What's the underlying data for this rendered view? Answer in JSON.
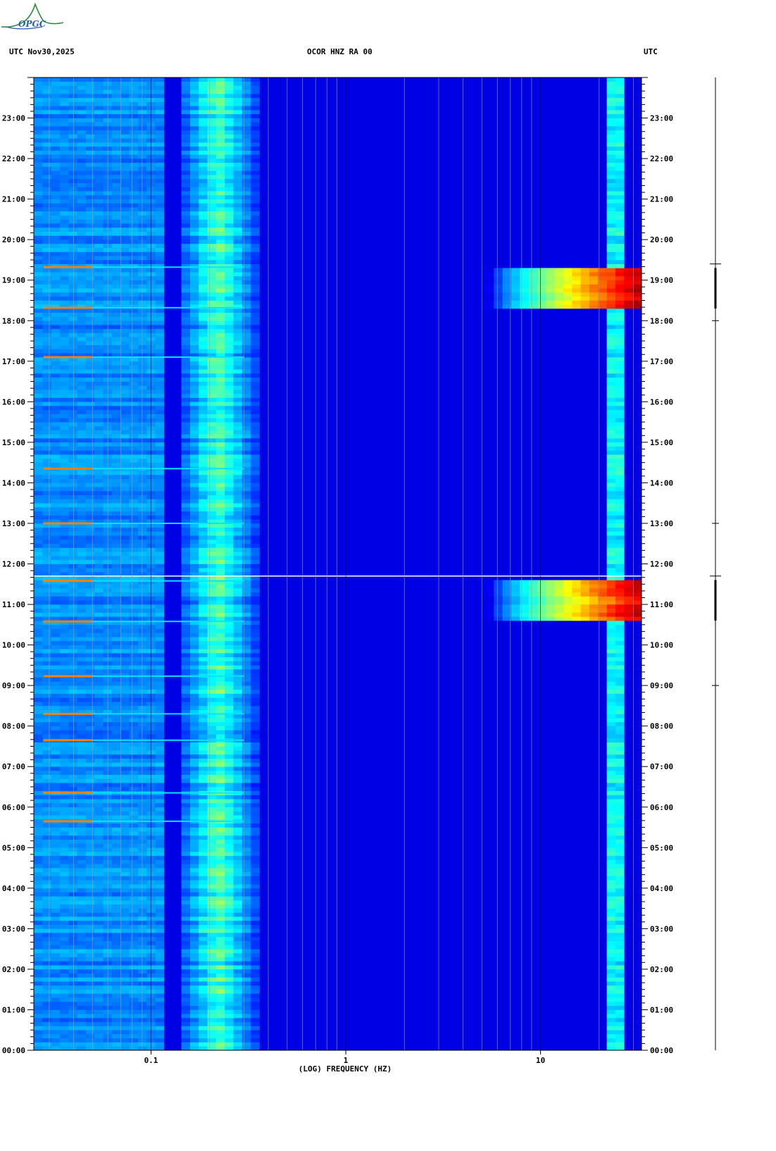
{
  "logo_text": "OPGC",
  "header": {
    "left": "UTC  Nov30,2025",
    "center": "OCOR HNZ RA 00",
    "right": "UTC"
  },
  "chart_data": {
    "type": "heatmap",
    "title": "OCOR HNZ RA 00",
    "date": "Nov30,2025",
    "xlabel": "(LOG) FREQUENCY (HZ)",
    "x_scale": "log",
    "xlim_hz": [
      0.025,
      33
    ],
    "x_ticks": [
      {
        "value": 0.1,
        "label": "0.1"
      },
      {
        "value": 1,
        "label": "1"
      },
      {
        "value": 10,
        "label": "10"
      }
    ],
    "ylabel": "UTC",
    "ylim_hours": [
      0,
      24
    ],
    "y_ticks": [
      "00:00",
      "01:00",
      "02:00",
      "03:00",
      "04:00",
      "05:00",
      "06:00",
      "07:00",
      "08:00",
      "09:00",
      "10:00",
      "11:00",
      "12:00",
      "13:00",
      "14:00",
      "15:00",
      "16:00",
      "17:00",
      "18:00",
      "19:00",
      "20:00",
      "21:00",
      "22:00",
      "23:00"
    ],
    "colormap": [
      "#00007f",
      "#0000ff",
      "#0080ff",
      "#00ffff",
      "#80ff80",
      "#ffff00",
      "#ff8000",
      "#ff0000",
      "#7f0000"
    ],
    "background_level": 0.1,
    "low_freq_band": {
      "f_range_hz": [
        0.025,
        0.12
      ],
      "level": 0.25
    },
    "microseism_band": {
      "f_range_hz": [
        0.14,
        0.35
      ],
      "level": 0.45
    },
    "high_freq_line_hz": 25,
    "bursts": [
      {
        "start_hour": 18.3,
        "end_hour": 19.3,
        "f_min_hz": 5,
        "peak_level": 1.0
      },
      {
        "start_hour": 10.6,
        "end_hour": 11.6,
        "f_min_hz": 5,
        "peak_level": 1.0
      }
    ],
    "horizontal_lines_hours": [
      19.32,
      18.32,
      17.1,
      14.35,
      13.0,
      11.58,
      10.58,
      9.23,
      8.3,
      7.65,
      6.35,
      5.65
    ],
    "white_gap_hour": 11.7
  }
}
